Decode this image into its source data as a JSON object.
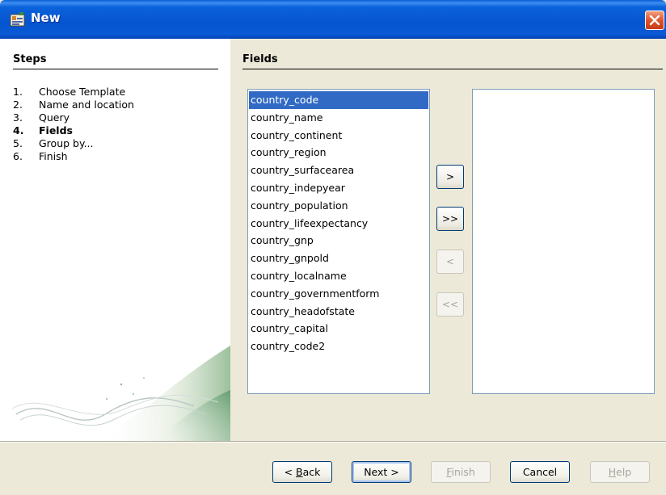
{
  "window": {
    "title": "New"
  },
  "steps": {
    "title": "Steps",
    "items": [
      {
        "num": "1.",
        "label": "Choose Template"
      },
      {
        "num": "2.",
        "label": "Name and location"
      },
      {
        "num": "3.",
        "label": "Query"
      },
      {
        "num": "4.",
        "label": "Fields"
      },
      {
        "num": "5.",
        "label": "Group by..."
      },
      {
        "num": "6.",
        "label": "Finish"
      }
    ],
    "active_index": 3
  },
  "fields": {
    "title": "Fields",
    "available": [
      "country_code",
      "country_name",
      "country_continent",
      "country_region",
      "country_surfacearea",
      "country_indepyear",
      "country_population",
      "country_lifeexpectancy",
      "country_gnp",
      "country_gnpold",
      "country_localname",
      "country_governmentform",
      "country_headofstate",
      "country_capital",
      "country_code2"
    ],
    "selected_item": "country_code",
    "chosen": []
  },
  "move_buttons": {
    "add": ">",
    "add_all": ">>",
    "remove": "<",
    "remove_all": "<<"
  },
  "buttons": {
    "back": {
      "prefix": "< ",
      "mnemonic": "B",
      "rest": "ack"
    },
    "next": "Next >",
    "finish": {
      "mnemonic": "F",
      "rest": "inish"
    },
    "cancel": "Cancel",
    "help": {
      "mnemonic": "H",
      "rest": "elp"
    }
  },
  "colors": {
    "titlebar": "#0554d0",
    "selection": "#316ac5",
    "window_bg": "#ece9d8",
    "close_button": "#e0542c"
  },
  "icons": {
    "app": "wizard-app-icon",
    "close": "close-icon"
  }
}
